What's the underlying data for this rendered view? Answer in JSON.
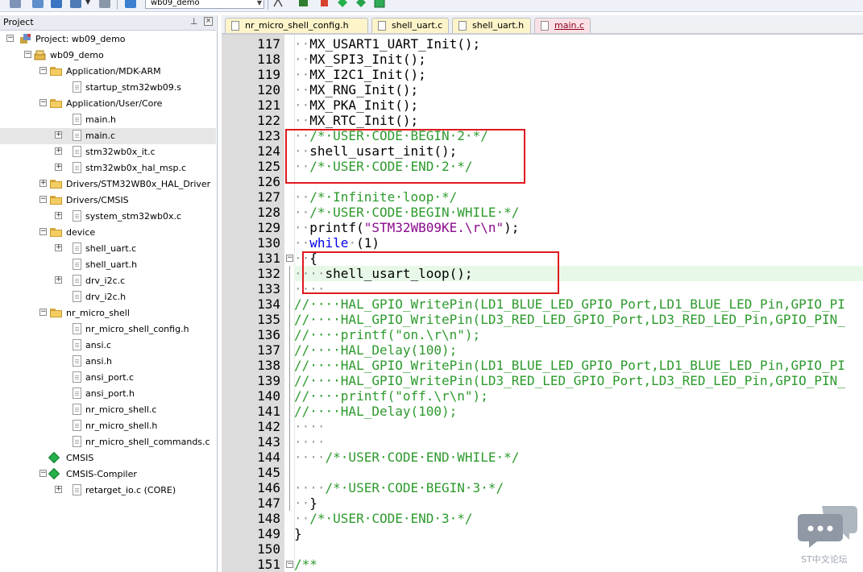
{
  "toolbar": {
    "target_name": "wb09_demo",
    "icons": [
      "rebuild-icon",
      "build-icon",
      "batch-build-icon",
      "layers-icon",
      "dropdown-arrow-icon",
      "translate-icon",
      "load-icon",
      "options-icon",
      "manage-icon"
    ]
  },
  "project_panel": {
    "title": "Project",
    "pin_glyph": "⊥",
    "close_glyph": "×",
    "tree": [
      {
        "label": "Project: wb09_demo",
        "level": 0,
        "type": "project",
        "expander": "-"
      },
      {
        "label": "wb09_demo",
        "level": 1,
        "type": "target",
        "expander": "-"
      },
      {
        "label": "Application/MDK-ARM",
        "level": 2,
        "type": "folder",
        "expander": "-"
      },
      {
        "label": "startup_stm32wb09.s",
        "level": 3,
        "type": "file",
        "expander": ""
      },
      {
        "label": "Application/User/Core",
        "level": 2,
        "type": "folder",
        "expander": "-"
      },
      {
        "label": "main.h",
        "level": 3,
        "type": "file",
        "expander": ""
      },
      {
        "label": "main.c",
        "level": 3,
        "type": "file",
        "expander": "+",
        "selected": true
      },
      {
        "label": "stm32wb0x_it.c",
        "level": 3,
        "type": "file",
        "expander": "+"
      },
      {
        "label": "stm32wb0x_hal_msp.c",
        "level": 3,
        "type": "file",
        "expander": "+"
      },
      {
        "label": "Drivers/STM32WB0x_HAL_Driver",
        "level": 2,
        "type": "folder",
        "expander": "+"
      },
      {
        "label": "Drivers/CMSIS",
        "level": 2,
        "type": "folder",
        "expander": "-"
      },
      {
        "label": "system_stm32wb0x.c",
        "level": 3,
        "type": "file",
        "expander": "+"
      },
      {
        "label": "device",
        "level": 2,
        "type": "folder",
        "expander": "-"
      },
      {
        "label": "shell_uart.c",
        "level": 3,
        "type": "file",
        "expander": "+"
      },
      {
        "label": "shell_uart.h",
        "level": 3,
        "type": "file",
        "expander": ""
      },
      {
        "label": "drv_i2c.c",
        "level": 3,
        "type": "file",
        "expander": "+"
      },
      {
        "label": "drv_i2c.h",
        "level": 3,
        "type": "file",
        "expander": ""
      },
      {
        "label": "nr_micro_shell",
        "level": 2,
        "type": "folder",
        "expander": "-"
      },
      {
        "label": "nr_micro_shell_config.h",
        "level": 3,
        "type": "file",
        "expander": ""
      },
      {
        "label": "ansi.c",
        "level": 3,
        "type": "file",
        "expander": ""
      },
      {
        "label": "ansi.h",
        "level": 3,
        "type": "file",
        "expander": ""
      },
      {
        "label": "ansi_port.c",
        "level": 3,
        "type": "file",
        "expander": ""
      },
      {
        "label": "ansi_port.h",
        "level": 3,
        "type": "file",
        "expander": ""
      },
      {
        "label": "nr_micro_shell.c",
        "level": 3,
        "type": "file",
        "expander": ""
      },
      {
        "label": "nr_micro_shell.h",
        "level": 3,
        "type": "file",
        "expander": ""
      },
      {
        "label": "nr_micro_shell_commands.c",
        "level": 3,
        "type": "file",
        "expander": ""
      },
      {
        "label": "CMSIS",
        "level": 2,
        "type": "component",
        "expander": ""
      },
      {
        "label": "CMSIS-Compiler",
        "level": 2,
        "type": "component",
        "expander": "-"
      },
      {
        "label": "retarget_io.c (CORE)",
        "level": 3,
        "type": "file",
        "expander": "+"
      }
    ]
  },
  "editor": {
    "tabs": [
      {
        "label": "nr_micro_shell_config.h",
        "style": "yellow"
      },
      {
        "label": "shell_uart.c",
        "style": "yellow"
      },
      {
        "label": "shell_uart.h",
        "style": "yellow"
      },
      {
        "label": "main.c",
        "style": "active"
      }
    ],
    "lines": [
      {
        "n": "117",
        "segs": [
          {
            "t": "··",
            "c": "dot"
          },
          {
            "t": "MX_USART1_UART_Init();",
            "c": ""
          }
        ]
      },
      {
        "n": "118",
        "segs": [
          {
            "t": "··",
            "c": "dot"
          },
          {
            "t": "MX_SPI3_Init();",
            "c": ""
          }
        ]
      },
      {
        "n": "119",
        "segs": [
          {
            "t": "··",
            "c": "dot"
          },
          {
            "t": "MX_I2C1_Init();",
            "c": ""
          }
        ]
      },
      {
        "n": "120",
        "segs": [
          {
            "t": "··",
            "c": "dot"
          },
          {
            "t": "MX_RNG_Init();",
            "c": ""
          }
        ]
      },
      {
        "n": "121",
        "segs": [
          {
            "t": "··",
            "c": "dot"
          },
          {
            "t": "MX_PKA_Init();",
            "c": ""
          }
        ]
      },
      {
        "n": "122",
        "segs": [
          {
            "t": "··",
            "c": "dot"
          },
          {
            "t": "MX_RTC_Init();",
            "c": ""
          }
        ]
      },
      {
        "n": "123",
        "segs": [
          {
            "t": "··",
            "c": "dot"
          },
          {
            "t": "/*·USER·CODE·BEGIN·2·*/",
            "c": "cm"
          }
        ]
      },
      {
        "n": "124",
        "segs": [
          {
            "t": "··",
            "c": "dot"
          },
          {
            "t": "shell_usart_init();",
            "c": ""
          }
        ]
      },
      {
        "n": "125",
        "segs": [
          {
            "t": "··",
            "c": "dot"
          },
          {
            "t": "/*·USER·CODE·END·2·*/",
            "c": "cm"
          }
        ]
      },
      {
        "n": "126",
        "segs": []
      },
      {
        "n": "127",
        "segs": [
          {
            "t": "··",
            "c": "dot"
          },
          {
            "t": "/*·Infinite·loop·*/",
            "c": "cm"
          }
        ]
      },
      {
        "n": "128",
        "segs": [
          {
            "t": "··",
            "c": "dot"
          },
          {
            "t": "/*·USER·CODE·BEGIN·WHILE·*/",
            "c": "cm"
          }
        ]
      },
      {
        "n": "129",
        "segs": [
          {
            "t": "··",
            "c": "dot"
          },
          {
            "t": "printf(",
            "c": ""
          },
          {
            "t": "\"STM32WB09KE.\\r\\n\"",
            "c": "str"
          },
          {
            "t": ");",
            "c": ""
          }
        ]
      },
      {
        "n": "130",
        "segs": [
          {
            "t": "··",
            "c": "dot"
          },
          {
            "t": "while",
            "c": "kw"
          },
          {
            "t": "·",
            "c": "dot"
          },
          {
            "t": "(1)",
            "c": ""
          }
        ]
      },
      {
        "n": "131",
        "segs": [
          {
            "t": "··",
            "c": "dot"
          },
          {
            "t": "{",
            "c": ""
          }
        ]
      },
      {
        "n": "132",
        "segs": [
          {
            "t": "····",
            "c": "dot"
          },
          {
            "t": "shell_usart_loop();",
            "c": ""
          }
        ],
        "current": true
      },
      {
        "n": "133",
        "segs": [
          {
            "t": "····",
            "c": "dot"
          }
        ]
      },
      {
        "n": "134",
        "segs": [
          {
            "t": "//····HAL_GPIO_WritePin(LD1_BLUE_LED_GPIO_Port,LD1_BLUE_LED_Pin,GPIO_PI",
            "c": "cm"
          }
        ]
      },
      {
        "n": "135",
        "segs": [
          {
            "t": "//····HAL_GPIO_WritePin(LD3_RED_LED_GPIO_Port,LD3_RED_LED_Pin,GPIO_PIN_",
            "c": "cm"
          }
        ]
      },
      {
        "n": "136",
        "segs": [
          {
            "t": "//····printf(\"on.\\r\\n\");",
            "c": "cm"
          }
        ]
      },
      {
        "n": "137",
        "segs": [
          {
            "t": "//····HAL_Delay(100);",
            "c": "cm"
          }
        ]
      },
      {
        "n": "138",
        "segs": [
          {
            "t": "//····HAL_GPIO_WritePin(LD1_BLUE_LED_GPIO_Port,LD1_BLUE_LED_Pin,GPIO_PI",
            "c": "cm"
          }
        ]
      },
      {
        "n": "139",
        "segs": [
          {
            "t": "//····HAL_GPIO_WritePin(LD3_RED_LED_GPIO_Port,LD3_RED_LED_Pin,GPIO_PIN_",
            "c": "cm"
          }
        ]
      },
      {
        "n": "140",
        "segs": [
          {
            "t": "//····printf(\"off.\\r\\n\");",
            "c": "cm"
          }
        ]
      },
      {
        "n": "141",
        "segs": [
          {
            "t": "//····HAL_Delay(100);",
            "c": "cm"
          }
        ]
      },
      {
        "n": "142",
        "segs": [
          {
            "t": "····",
            "c": "dot"
          }
        ]
      },
      {
        "n": "143",
        "segs": [
          {
            "t": "····",
            "c": "dot"
          }
        ]
      },
      {
        "n": "144",
        "segs": [
          {
            "t": "····",
            "c": "dot"
          },
          {
            "t": "/*·USER·CODE·END·WHILE·*/",
            "c": "cm"
          }
        ]
      },
      {
        "n": "145",
        "segs": []
      },
      {
        "n": "146",
        "segs": [
          {
            "t": "····",
            "c": "dot"
          },
          {
            "t": "/*·USER·CODE·BEGIN·3·*/",
            "c": "cm"
          }
        ]
      },
      {
        "n": "147",
        "segs": [
          {
            "t": "··",
            "c": "dot"
          },
          {
            "t": "}",
            "c": ""
          }
        ]
      },
      {
        "n": "148",
        "segs": [
          {
            "t": "··",
            "c": "dot"
          },
          {
            "t": "/*·USER·CODE·END·3·*/",
            "c": "cm"
          }
        ]
      },
      {
        "n": "149",
        "segs": [
          {
            "t": "}",
            "c": ""
          }
        ]
      },
      {
        "n": "150",
        "segs": []
      },
      {
        "n": "151",
        "segs": [
          {
            "t": "/**",
            "c": "cm"
          }
        ]
      }
    ]
  },
  "watermark": {
    "label": "ST中文论坛"
  },
  "colors": {
    "comment": "#2d9a2d",
    "keyword": "#0000ee",
    "string": "#8a0a8a",
    "annotation_box": "#e0191f",
    "current_line": "#e8f8e8",
    "gutter": "#dcdcdc",
    "active_tab": "#fbe1e6",
    "inactive_tab": "#fdf4c9"
  }
}
